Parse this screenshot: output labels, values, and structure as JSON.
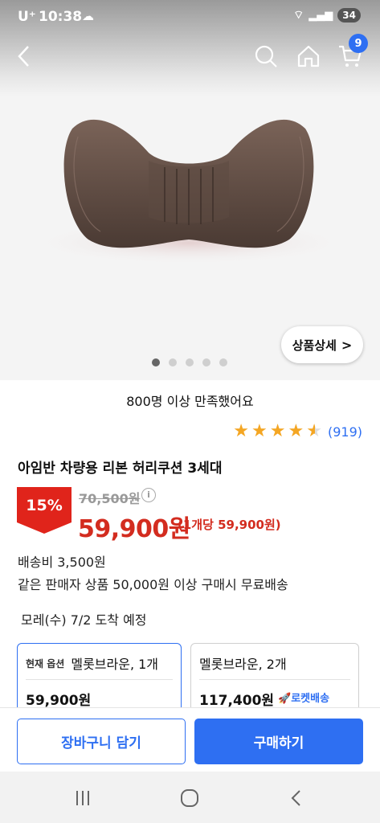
{
  "status_bar": {
    "carrier": "U⁺",
    "time": "10:38",
    "battery": "34"
  },
  "header": {
    "cart_count": "9"
  },
  "gallery": {
    "detail_button": "상품상세",
    "page_count": 5,
    "active_index": 0
  },
  "product": {
    "satisfaction": "800명 이상 만족했어요",
    "rating": 4.5,
    "review_count": "(919)",
    "title": "아임반 차량용 리본 허리쿠션 3세대",
    "discount": "15%",
    "original_price": "70,500원",
    "sale_price": "59,900원",
    "unit_price": "(1개당 59,900원)",
    "shipping_fee": "배송비 3,500원",
    "free_shipping": "같은 판매자 상품 50,000원 이상 구매시 무료배송",
    "arrival": "모레(수) 7/2 도착 예정"
  },
  "options": [
    {
      "tag": "현재 옵션",
      "label": "멜롯브라운, 1개",
      "price": "59,900원",
      "badge": ""
    },
    {
      "tag": "",
      "label": "멜롯브라운, 2개",
      "price": "117,400원",
      "badge": "로켓배송"
    }
  ],
  "actions": {
    "add_to_cart": "장바구니 담기",
    "buy_now": "구매하기"
  },
  "colors": {
    "accent": "#2e6ff2",
    "sale": "#d32c1f",
    "star": "#f4a623"
  }
}
